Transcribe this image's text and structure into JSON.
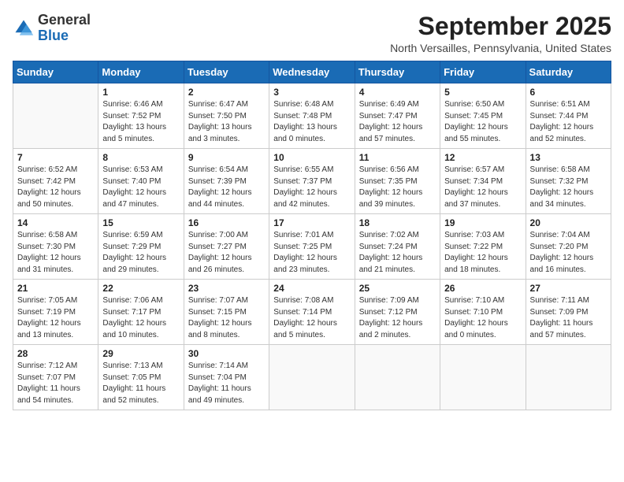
{
  "header": {
    "logo_general": "General",
    "logo_blue": "Blue",
    "month_title": "September 2025",
    "location": "North Versailles, Pennsylvania, United States"
  },
  "weekdays": [
    "Sunday",
    "Monday",
    "Tuesday",
    "Wednesday",
    "Thursday",
    "Friday",
    "Saturday"
  ],
  "weeks": [
    [
      {
        "day": "",
        "info": ""
      },
      {
        "day": "1",
        "info": "Sunrise: 6:46 AM\nSunset: 7:52 PM\nDaylight: 13 hours\nand 5 minutes."
      },
      {
        "day": "2",
        "info": "Sunrise: 6:47 AM\nSunset: 7:50 PM\nDaylight: 13 hours\nand 3 minutes."
      },
      {
        "day": "3",
        "info": "Sunrise: 6:48 AM\nSunset: 7:48 PM\nDaylight: 13 hours\nand 0 minutes."
      },
      {
        "day": "4",
        "info": "Sunrise: 6:49 AM\nSunset: 7:47 PM\nDaylight: 12 hours\nand 57 minutes."
      },
      {
        "day": "5",
        "info": "Sunrise: 6:50 AM\nSunset: 7:45 PM\nDaylight: 12 hours\nand 55 minutes."
      },
      {
        "day": "6",
        "info": "Sunrise: 6:51 AM\nSunset: 7:44 PM\nDaylight: 12 hours\nand 52 minutes."
      }
    ],
    [
      {
        "day": "7",
        "info": "Sunrise: 6:52 AM\nSunset: 7:42 PM\nDaylight: 12 hours\nand 50 minutes."
      },
      {
        "day": "8",
        "info": "Sunrise: 6:53 AM\nSunset: 7:40 PM\nDaylight: 12 hours\nand 47 minutes."
      },
      {
        "day": "9",
        "info": "Sunrise: 6:54 AM\nSunset: 7:39 PM\nDaylight: 12 hours\nand 44 minutes."
      },
      {
        "day": "10",
        "info": "Sunrise: 6:55 AM\nSunset: 7:37 PM\nDaylight: 12 hours\nand 42 minutes."
      },
      {
        "day": "11",
        "info": "Sunrise: 6:56 AM\nSunset: 7:35 PM\nDaylight: 12 hours\nand 39 minutes."
      },
      {
        "day": "12",
        "info": "Sunrise: 6:57 AM\nSunset: 7:34 PM\nDaylight: 12 hours\nand 37 minutes."
      },
      {
        "day": "13",
        "info": "Sunrise: 6:58 AM\nSunset: 7:32 PM\nDaylight: 12 hours\nand 34 minutes."
      }
    ],
    [
      {
        "day": "14",
        "info": "Sunrise: 6:58 AM\nSunset: 7:30 PM\nDaylight: 12 hours\nand 31 minutes."
      },
      {
        "day": "15",
        "info": "Sunrise: 6:59 AM\nSunset: 7:29 PM\nDaylight: 12 hours\nand 29 minutes."
      },
      {
        "day": "16",
        "info": "Sunrise: 7:00 AM\nSunset: 7:27 PM\nDaylight: 12 hours\nand 26 minutes."
      },
      {
        "day": "17",
        "info": "Sunrise: 7:01 AM\nSunset: 7:25 PM\nDaylight: 12 hours\nand 23 minutes."
      },
      {
        "day": "18",
        "info": "Sunrise: 7:02 AM\nSunset: 7:24 PM\nDaylight: 12 hours\nand 21 minutes."
      },
      {
        "day": "19",
        "info": "Sunrise: 7:03 AM\nSunset: 7:22 PM\nDaylight: 12 hours\nand 18 minutes."
      },
      {
        "day": "20",
        "info": "Sunrise: 7:04 AM\nSunset: 7:20 PM\nDaylight: 12 hours\nand 16 minutes."
      }
    ],
    [
      {
        "day": "21",
        "info": "Sunrise: 7:05 AM\nSunset: 7:19 PM\nDaylight: 12 hours\nand 13 minutes."
      },
      {
        "day": "22",
        "info": "Sunrise: 7:06 AM\nSunset: 7:17 PM\nDaylight: 12 hours\nand 10 minutes."
      },
      {
        "day": "23",
        "info": "Sunrise: 7:07 AM\nSunset: 7:15 PM\nDaylight: 12 hours\nand 8 minutes."
      },
      {
        "day": "24",
        "info": "Sunrise: 7:08 AM\nSunset: 7:14 PM\nDaylight: 12 hours\nand 5 minutes."
      },
      {
        "day": "25",
        "info": "Sunrise: 7:09 AM\nSunset: 7:12 PM\nDaylight: 12 hours\nand 2 minutes."
      },
      {
        "day": "26",
        "info": "Sunrise: 7:10 AM\nSunset: 7:10 PM\nDaylight: 12 hours\nand 0 minutes."
      },
      {
        "day": "27",
        "info": "Sunrise: 7:11 AM\nSunset: 7:09 PM\nDaylight: 11 hours\nand 57 minutes."
      }
    ],
    [
      {
        "day": "28",
        "info": "Sunrise: 7:12 AM\nSunset: 7:07 PM\nDaylight: 11 hours\nand 54 minutes."
      },
      {
        "day": "29",
        "info": "Sunrise: 7:13 AM\nSunset: 7:05 PM\nDaylight: 11 hours\nand 52 minutes."
      },
      {
        "day": "30",
        "info": "Sunrise: 7:14 AM\nSunset: 7:04 PM\nDaylight: 11 hours\nand 49 minutes."
      },
      {
        "day": "",
        "info": ""
      },
      {
        "day": "",
        "info": ""
      },
      {
        "day": "",
        "info": ""
      },
      {
        "day": "",
        "info": ""
      }
    ]
  ]
}
